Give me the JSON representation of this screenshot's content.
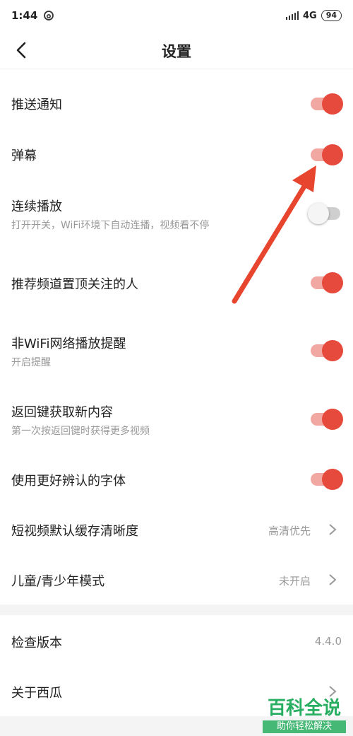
{
  "status_bar": {
    "time": "1:44",
    "network": "4G",
    "battery": "94"
  },
  "nav": {
    "title": "设置"
  },
  "settings": [
    {
      "label": "推送通知",
      "on": true
    },
    {
      "label": "弹幕",
      "on": true
    },
    {
      "label": "连续播放",
      "subtitle": "打开开关，WiFi环境下自动连播，视频看不停",
      "on": false
    },
    {
      "label": "推荐频道置顶关注的人",
      "on": true
    },
    {
      "label": "非WiFi网络播放提醒",
      "subtitle": "开启提醒",
      "on": true
    },
    {
      "label": "返回键获取新内容",
      "subtitle": "第一次按返回键时获得更多视频",
      "on": true
    },
    {
      "label": "使用更好辨认的字体",
      "on": true
    },
    {
      "label": "短视频默认缓存清晰度",
      "value": "高清优先"
    },
    {
      "label": "儿童/青少年模式",
      "value": "未开启"
    },
    {
      "label": "检查版本",
      "value": "4.4.0"
    },
    {
      "label": "关于西瓜"
    }
  ],
  "watermark": {
    "main": "百科全说",
    "sub": "助你轻松解决"
  },
  "colors": {
    "accent": "#e64a3c",
    "track_on": "#f2a8a2",
    "annotation_arrow": "#e8452e"
  }
}
